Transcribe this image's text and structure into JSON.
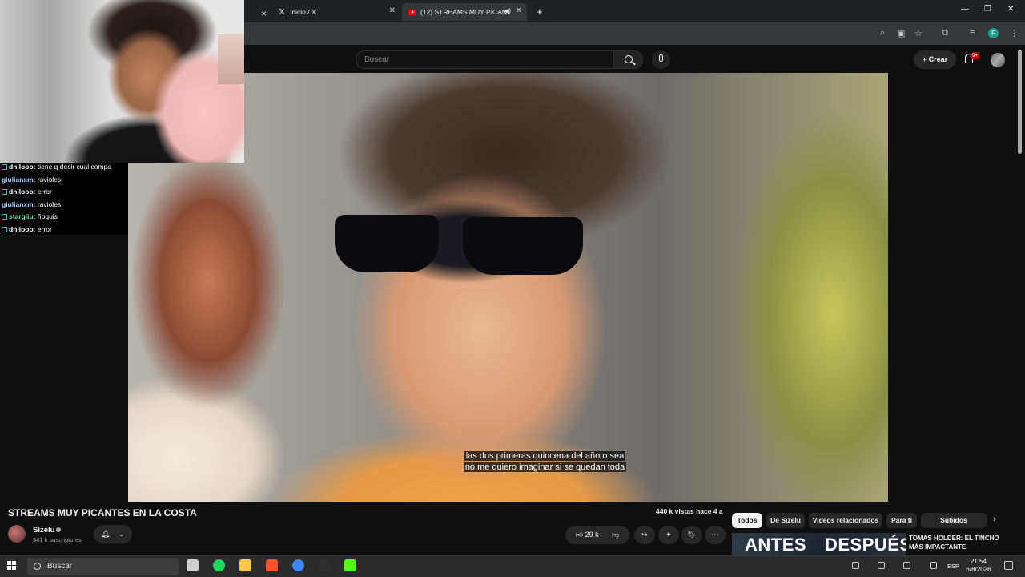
{
  "browser": {
    "tabs": [
      {
        "label": "Inicio / X"
      },
      {
        "label": "(12) STREAMS MUY PICANT"
      }
    ],
    "profile_initial": "F",
    "icons": [
      "zoom-icon",
      "cast-icon",
      "star-icon",
      "extensions-icon",
      "media-icon",
      "menu-icon"
    ]
  },
  "youtube": {
    "search_placeholder": "Buscar",
    "create_label": "+ Crear",
    "notification_count": "9+"
  },
  "chat": {
    "messages": [
      {
        "user": "dnilooo",
        "text": "tiene q decir cual compa",
        "badge": true,
        "color": "#ffffff"
      },
      {
        "user": "giulianxm",
        "text": "ravioles",
        "badge": false,
        "color": "#a9c8ff"
      },
      {
        "user": "dnilooo",
        "text": "error",
        "badge": true,
        "color": "#ffffff"
      },
      {
        "user": "giulianxm",
        "text": "ravioles",
        "badge": false,
        "color": "#a9c8ff"
      },
      {
        "user": "stargiiu",
        "text": "ñoquis",
        "badge": true,
        "color": "#7fe0a0"
      },
      {
        "user": "dnilooo",
        "text": "error",
        "badge": true,
        "color": "#ffffff"
      }
    ]
  },
  "video": {
    "subtitle_line1": "las dos primeras quincena del año o sea",
    "subtitle_line2": "no me quiero imaginar si se quedan toda",
    "title": "STREAMS MUY PICANTES EN LA COSTA",
    "views": "440 k vistas  hace 4 a",
    "channel": "Sizelu",
    "subscribers": "341 k suscriptores",
    "likes": "29 k"
  },
  "chips": [
    "Todos",
    "De Sizelu",
    "Videos relacionados",
    "Para ti",
    "Subidos recientemente"
  ],
  "recommendation": {
    "thumb_left": "ANTES",
    "thumb_right": "DESPUÉS",
    "title": "TOMAS HOLDER: EL TINCHO MÁS IMPACTANTE"
  },
  "taskbar": {
    "search_label": "Buscar",
    "language": "ESP",
    "time": "21:54",
    "date": "6/8/2026",
    "apps": [
      {
        "name": "task-view-icon",
        "color": "#cfcfcf"
      },
      {
        "name": "spotify-icon",
        "color": "#1ed760"
      },
      {
        "name": "file-explorer-icon",
        "color": "#f2c94c"
      },
      {
        "name": "brave-icon",
        "color": "#fb542b"
      },
      {
        "name": "chrome-icon",
        "color": "#4285f4"
      },
      {
        "name": "obs-icon",
        "color": "#303030"
      },
      {
        "name": "kick-icon",
        "color": "#53fc18"
      }
    ]
  }
}
